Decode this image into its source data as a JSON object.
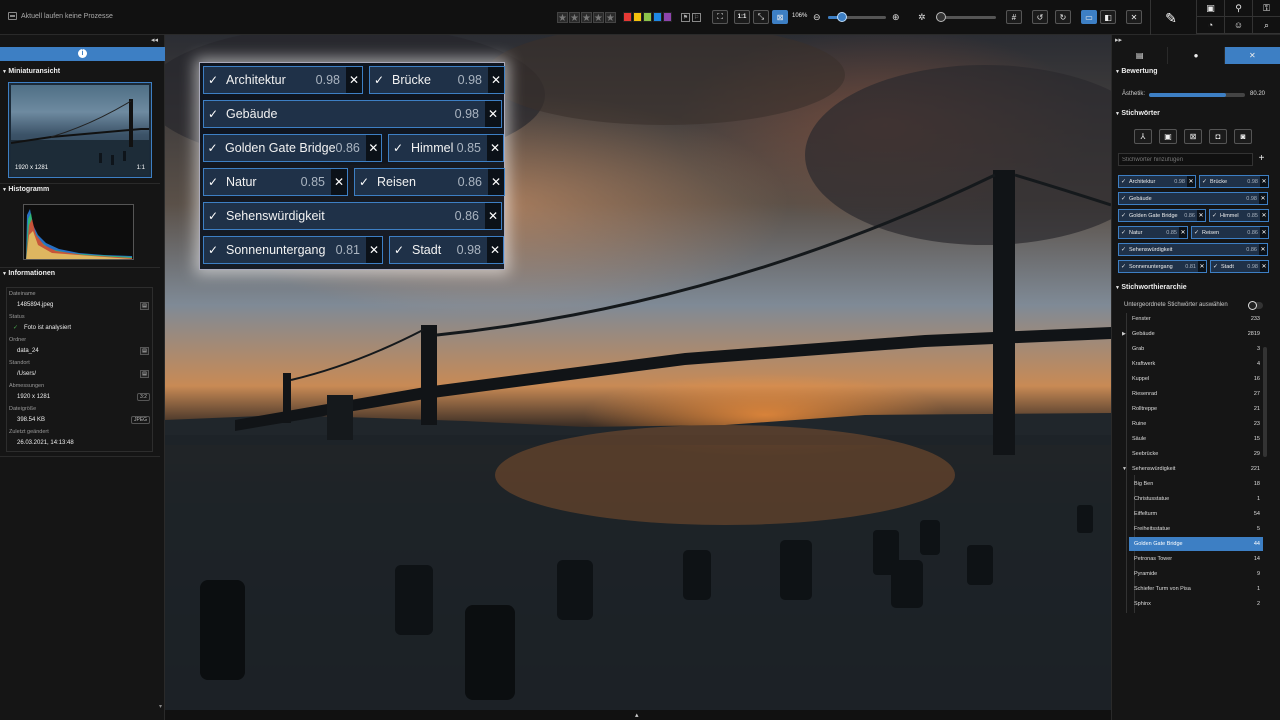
{
  "topbar": {
    "process_status": "Aktuell laufen keine Prozesse",
    "stars": [
      "★",
      "★",
      "★",
      "★",
      "★"
    ],
    "color_labels": [
      "#e53935",
      "#f4c20d",
      "#8bc34a",
      "#1e88e5",
      "#8e44ad"
    ],
    "fit_label": "1:1",
    "zoom_value": "106%",
    "zoom_level": 0.15,
    "brightness_level": 0.0
  },
  "left": {
    "sections": {
      "thumbnail": "Miniaturansicht",
      "histogram": "Histogramm",
      "info": "Informationen"
    },
    "thumb": {
      "dimensions": "1920 x 1281",
      "ratio": "1:1"
    },
    "info": {
      "filename_label": "Dateiname",
      "filename": "1485894.jpeg",
      "status_label": "Status",
      "status": "Foto ist analysiert",
      "folder_label": "Ordner",
      "folder": "data_24",
      "location_label": "Standort",
      "location": "/Users/",
      "dimensions_label": "Abmessungen",
      "dimensions": "1920 x 1281",
      "aspect": "3:2",
      "filesize_label": "Dateigröße",
      "filesize": "398.54 KB",
      "format": "JPEG",
      "modified_label": "Zuletzt geändert",
      "modified": "26.03.2021, 14:13:48"
    }
  },
  "overlay_tags": [
    {
      "name": "Architektur",
      "score": "0.98"
    },
    {
      "name": "Brücke",
      "score": "0.98"
    },
    {
      "name": "Gebäude",
      "score": "0.98"
    },
    {
      "name": "Golden Gate Bridge",
      "score": "0.86"
    },
    {
      "name": "Himmel",
      "score": "0.85"
    },
    {
      "name": "Natur",
      "score": "0.85"
    },
    {
      "name": "Reisen",
      "score": "0.86"
    },
    {
      "name": "Sehenswürdigkeit",
      "score": "0.86"
    },
    {
      "name": "Sonnenuntergang",
      "score": "0.81"
    },
    {
      "name": "Stadt",
      "score": "0.98"
    }
  ],
  "right": {
    "rating_section": "Bewertung",
    "aesthetic_label": "Ästhetik:",
    "aesthetic_value": "80.20",
    "aesthetic_level": 0.802,
    "keywords_section": "Stichwörter",
    "keywords_placeholder": "Stichwörter hinzufügen",
    "hierarchy_section": "Stichworthierarchie",
    "hierarchy_sub": "Untergeordnete Stichwörter auswählen",
    "hierarchy": [
      {
        "name": "Fenster",
        "count": "233",
        "arrow": "",
        "indent": 0
      },
      {
        "name": "Gebäude",
        "count": "2819",
        "arrow": "▶",
        "indent": 0
      },
      {
        "name": "Grab",
        "count": "3",
        "arrow": "",
        "indent": 0
      },
      {
        "name": "Kraftwerk",
        "count": "4",
        "arrow": "",
        "indent": 0
      },
      {
        "name": "Kuppel",
        "count": "16",
        "arrow": "",
        "indent": 0
      },
      {
        "name": "Riesenrad",
        "count": "27",
        "arrow": "",
        "indent": 0
      },
      {
        "name": "Rolltreppe",
        "count": "21",
        "arrow": "",
        "indent": 0
      },
      {
        "name": "Ruine",
        "count": "23",
        "arrow": "",
        "indent": 0
      },
      {
        "name": "Säule",
        "count": "15",
        "arrow": "",
        "indent": 0
      },
      {
        "name": "Seebrücke",
        "count": "29",
        "arrow": "",
        "indent": 0
      },
      {
        "name": "Sehenswürdigkeit",
        "count": "221",
        "arrow": "▼",
        "indent": 0
      },
      {
        "name": "Big Ben",
        "count": "18",
        "arrow": "",
        "indent": 1
      },
      {
        "name": "Christusstatue",
        "count": "1",
        "arrow": "",
        "indent": 1
      },
      {
        "name": "Eiffelturm",
        "count": "54",
        "arrow": "",
        "indent": 1
      },
      {
        "name": "Freiheitsstatue",
        "count": "5",
        "arrow": "",
        "indent": 1
      },
      {
        "name": "Golden Gate Bridge",
        "count": "44",
        "arrow": "",
        "indent": 1,
        "selected": true
      },
      {
        "name": "Petronas Tower",
        "count": "14",
        "arrow": "",
        "indent": 1
      },
      {
        "name": "Pyramide",
        "count": "9",
        "arrow": "",
        "indent": 1
      },
      {
        "name": "Schiefer Turm von Pisa",
        "count": "1",
        "arrow": "",
        "indent": 1
      },
      {
        "name": "Sphinx",
        "count": "2",
        "arrow": "",
        "indent": 1
      }
    ]
  }
}
